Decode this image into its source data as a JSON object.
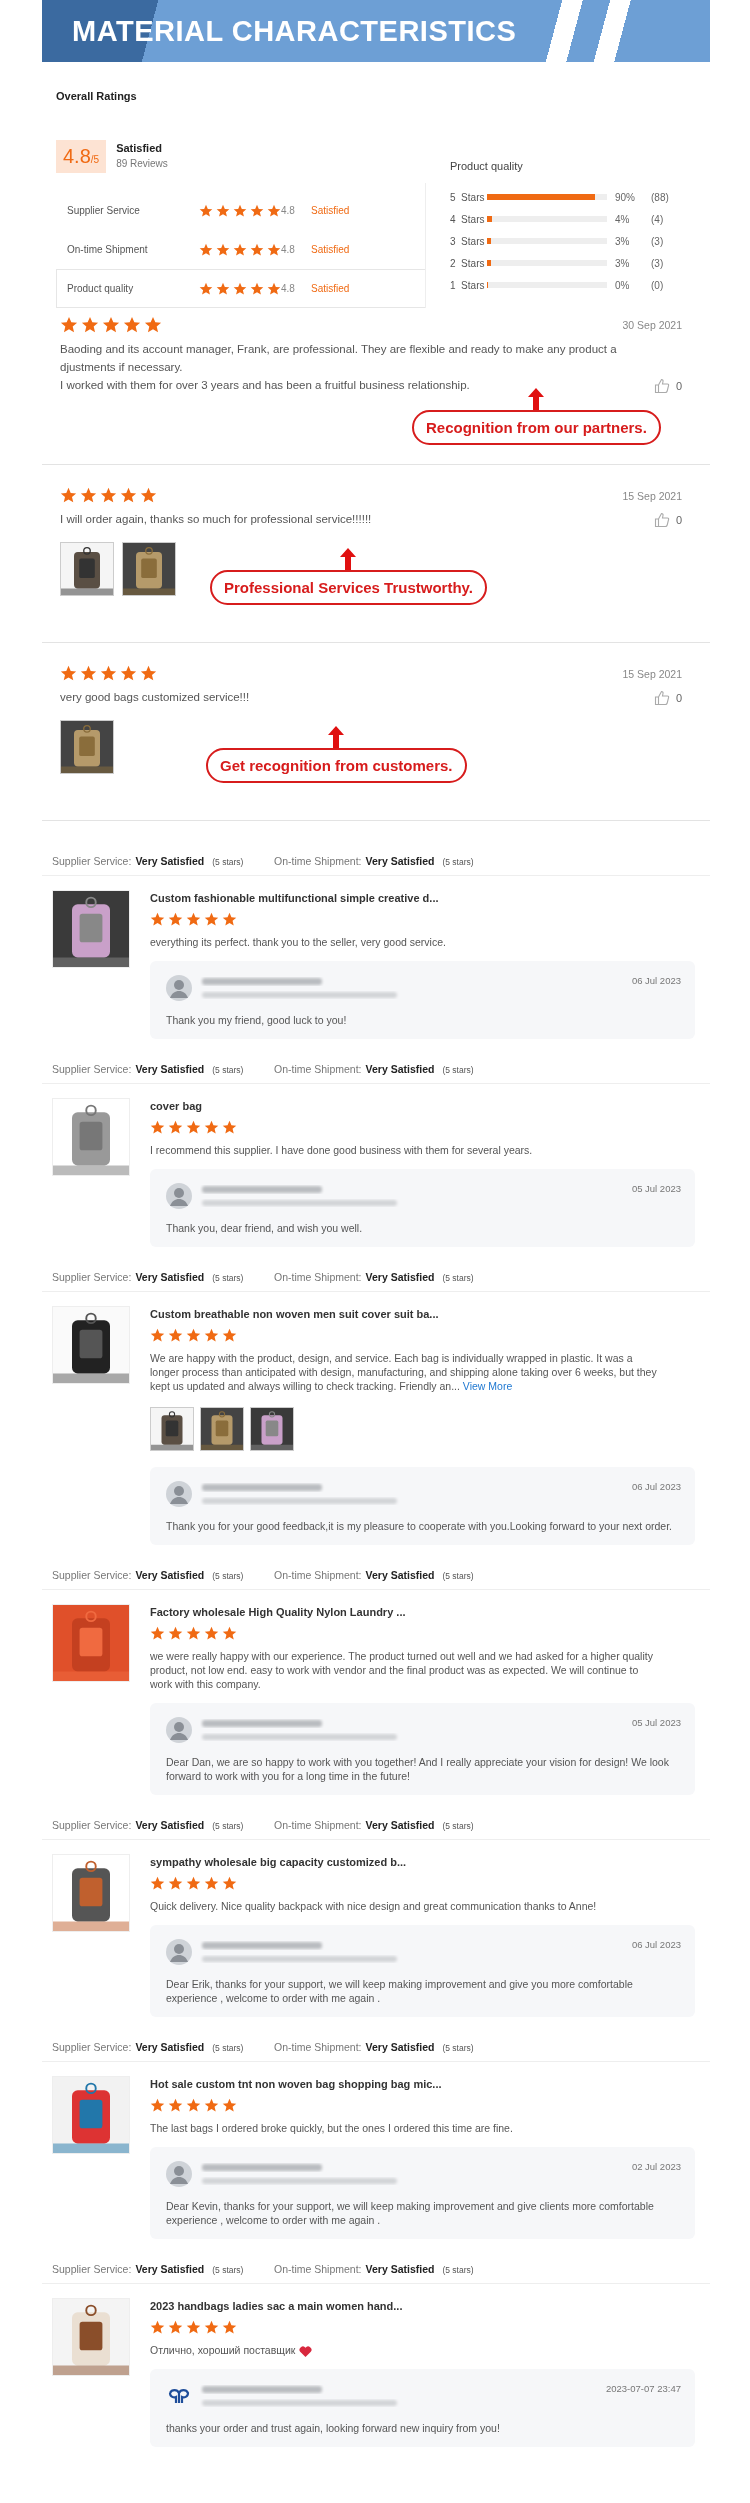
{
  "banner": {
    "title": "MATERIAL CHARACTERISTICS"
  },
  "overall": {
    "heading": "Overall Ratings",
    "score": "4.8",
    "scale": "/5",
    "verdict": "Satisfied",
    "reviews": "89 Reviews",
    "categories": [
      {
        "label": "Supplier Service",
        "stars": 5,
        "score": "4.8",
        "verdict": "Satisfied",
        "selected": false
      },
      {
        "label": "On-time Shipment",
        "stars": 5,
        "score": "4.8",
        "verdict": "Satisfied",
        "selected": false
      },
      {
        "label": "Product quality",
        "stars": 5,
        "score": "4.8",
        "verdict": "Satisfied",
        "selected": true
      }
    ],
    "breakdown": {
      "title": "Product quality",
      "rows": [
        {
          "label": "5  Stars",
          "level": 0.9,
          "percent": "90%",
          "count": "(88)"
        },
        {
          "label": "4  Stars",
          "level": 0.04,
          "percent": "4%",
          "count": "(4)"
        },
        {
          "label": "3  Stars",
          "level": 0.03,
          "percent": "3%",
          "count": "(3)"
        },
        {
          "label": "2  Stars",
          "level": 0.03,
          "percent": "3%",
          "count": "(3)"
        },
        {
          "label": "1  Stars",
          "level": 0,
          "percent": "0%",
          "count": "(0)"
        }
      ]
    }
  },
  "top_reviews": [
    {
      "stars": 5,
      "date": "30 Sep 2021",
      "paragraphs": [
        "Baoding and its account manager, Frank, are professional. They are flexible and ready to make any product adjustments if necessary.",
        "I worked with them for over 3 years and has been a fruitful business relationship."
      ],
      "likes": "0",
      "callout": "Recognition from our partners."
    },
    {
      "stars": 5,
      "date": "15 Sep 2021",
      "paragraphs": [
        "I will order again, thanks so much for professional service!!!!!!"
      ],
      "likes": "0",
      "photos": [
        {
          "kind": "picture"
        },
        {
          "kind": "picture"
        }
      ],
      "callout": "Professional Services Trustworthy."
    },
    {
      "stars": 5,
      "date": "15 Sep 2021",
      "paragraphs": [
        "very good bags customized service!!!"
      ],
      "likes": "0",
      "photos": [
        {
          "kind": "picture"
        }
      ],
      "callout": "Get recognition from customers."
    }
  ],
  "product_reviews": [
    {
      "ratings": {
        "supplier_label": "Supplier Service:",
        "supplier_value": "Very Satisfied",
        "supplier_stars": "(5 stars)",
        "shipment_label": "On-time Shipment:",
        "shipment_value": "Very Satisfied",
        "shipment_stars": "(5 stars)"
      },
      "image": {
        "kind": "picture"
      },
      "title": "Custom fashionable multifunctional simple creative d...",
      "stars": 5,
      "text": "everything its perfect. thank you to the seller, very good service.",
      "reply": {
        "avatar": {
          "kind": "person"
        },
        "date": "06 Jul 2023",
        "text": "Thank you my friend, good luck to you!"
      }
    },
    {
      "ratings": {
        "supplier_label": "Supplier Service:",
        "supplier_value": "Very Satisfied",
        "supplier_stars": "(5 stars)",
        "shipment_label": "On-time Shipment:",
        "shipment_value": "Very Satisfied",
        "shipment_stars": "(5 stars)"
      },
      "image": {
        "kind": "picture"
      },
      "title": "cover bag",
      "stars": 5,
      "text": "I recommend this supplier. I have done good business with them for several years.",
      "reply": {
        "avatar": {
          "kind": "person"
        },
        "date": "05 Jul 2023",
        "text": "Thank you, dear friend, and wish you well."
      }
    },
    {
      "ratings": {
        "supplier_label": "Supplier Service:",
        "supplier_value": "Very Satisfied",
        "supplier_stars": "(5 stars)",
        "shipment_label": "On-time Shipment:",
        "shipment_value": "Very Satisfied",
        "shipment_stars": "(5 stars)"
      },
      "image": {
        "kind": "picture"
      },
      "title": "Custom breathable non woven men suit cover suit ba...",
      "stars": 5,
      "text": "We are happy with the product, design, and service. Each bag is individually wrapped in plastic. It was a longer process than anticipated with design, manufacturing, and shipping alone taking over 6 weeks, but they kept us updated and always willing to check tracking. Friendly an...",
      "view_more": "View More",
      "photos": [
        {
          "kind": "picture"
        },
        {
          "kind": "picture"
        },
        {
          "kind": "picture"
        }
      ],
      "reply": {
        "avatar": {
          "kind": "person"
        },
        "date": "06 Jul 2023",
        "text": "Thank you for your good feedback,it is my pleasure to cooperate with you.Looking forward to your next order."
      }
    },
    {
      "ratings": {
        "supplier_label": "Supplier Service:",
        "supplier_value": "Very Satisfied",
        "supplier_stars": "(5 stars)",
        "shipment_label": "On-time Shipment:",
        "shipment_value": "Very Satisfied",
        "shipment_stars": "(5 stars)"
      },
      "image": {
        "kind": "picture"
      },
      "title": "Factory wholesale High Quality Nylon Laundry ...",
      "stars": 5,
      "text": "we were really happy with our experience. The product turned out well and we had asked for a higher quality product, not low end. easy to work with vendor and the final product was as expected. We will continue to work with this company.",
      "reply": {
        "avatar": {
          "kind": "person"
        },
        "date": "05 Jul 2023",
        "text": "Dear Dan, we are so happy to work with you together! And I really appreciate your vision for design! We look forward to work with you for a long time in the future!"
      }
    },
    {
      "ratings": {
        "supplier_label": "Supplier Service:",
        "supplier_value": "Very Satisfied",
        "supplier_stars": "(5 stars)",
        "shipment_label": "On-time Shipment:",
        "shipment_value": "Very Satisfied",
        "shipment_stars": "(5 stars)"
      },
      "image": {
        "kind": "picture"
      },
      "title": "sympathy wholesale big capacity customized b...",
      "stars": 5,
      "text": "Quick delivery. Nice quality backpack with nice design and great communication thanks to Anne!",
      "reply": {
        "avatar": {
          "kind": "person"
        },
        "date": "06 Jul 2023",
        "text": "Dear Erik, thanks for your support, we will keep making improvement and give you more comfortable experience , welcome to order with me again ."
      }
    },
    {
      "ratings": {
        "supplier_label": "Supplier Service:",
        "supplier_value": "Very Satisfied",
        "supplier_stars": "(5 stars)",
        "shipment_label": "On-time Shipment:",
        "shipment_value": "Very Satisfied",
        "shipment_stars": "(5 stars)"
      },
      "image": {
        "kind": "picture"
      },
      "title": "Hot sale custom tnt non woven bag shopping bag mic...",
      "stars": 5,
      "text": "The last bags I ordered broke quickly, but the ones I ordered this time are fine.",
      "reply": {
        "avatar": {
          "kind": "person"
        },
        "date": "02 Jul 2023",
        "text": "Dear Kevin, thanks for your support, we will keep making improvement and give clients more comfortable experience , welcome to order with me again ."
      }
    },
    {
      "ratings": {
        "supplier_label": "Supplier Service:",
        "supplier_value": "Very Satisfied",
        "supplier_stars": "(5 stars)",
        "shipment_label": "On-time Shipment:",
        "shipment_value": "Very Satisfied",
        "shipment_stars": "(5 stars)"
      },
      "image": {
        "kind": "picture"
      },
      "title": "2023 handbags ladies sac a main women hand...",
      "stars": 5,
      "text": "Отлично, хороший поставщик",
      "heart": true,
      "reply": {
        "avatar": {
          "kind": "logo"
        },
        "date": "2023-07-07 23:47",
        "text": "thanks your order and trust again, looking forward new inquiry from you!"
      }
    }
  ]
}
